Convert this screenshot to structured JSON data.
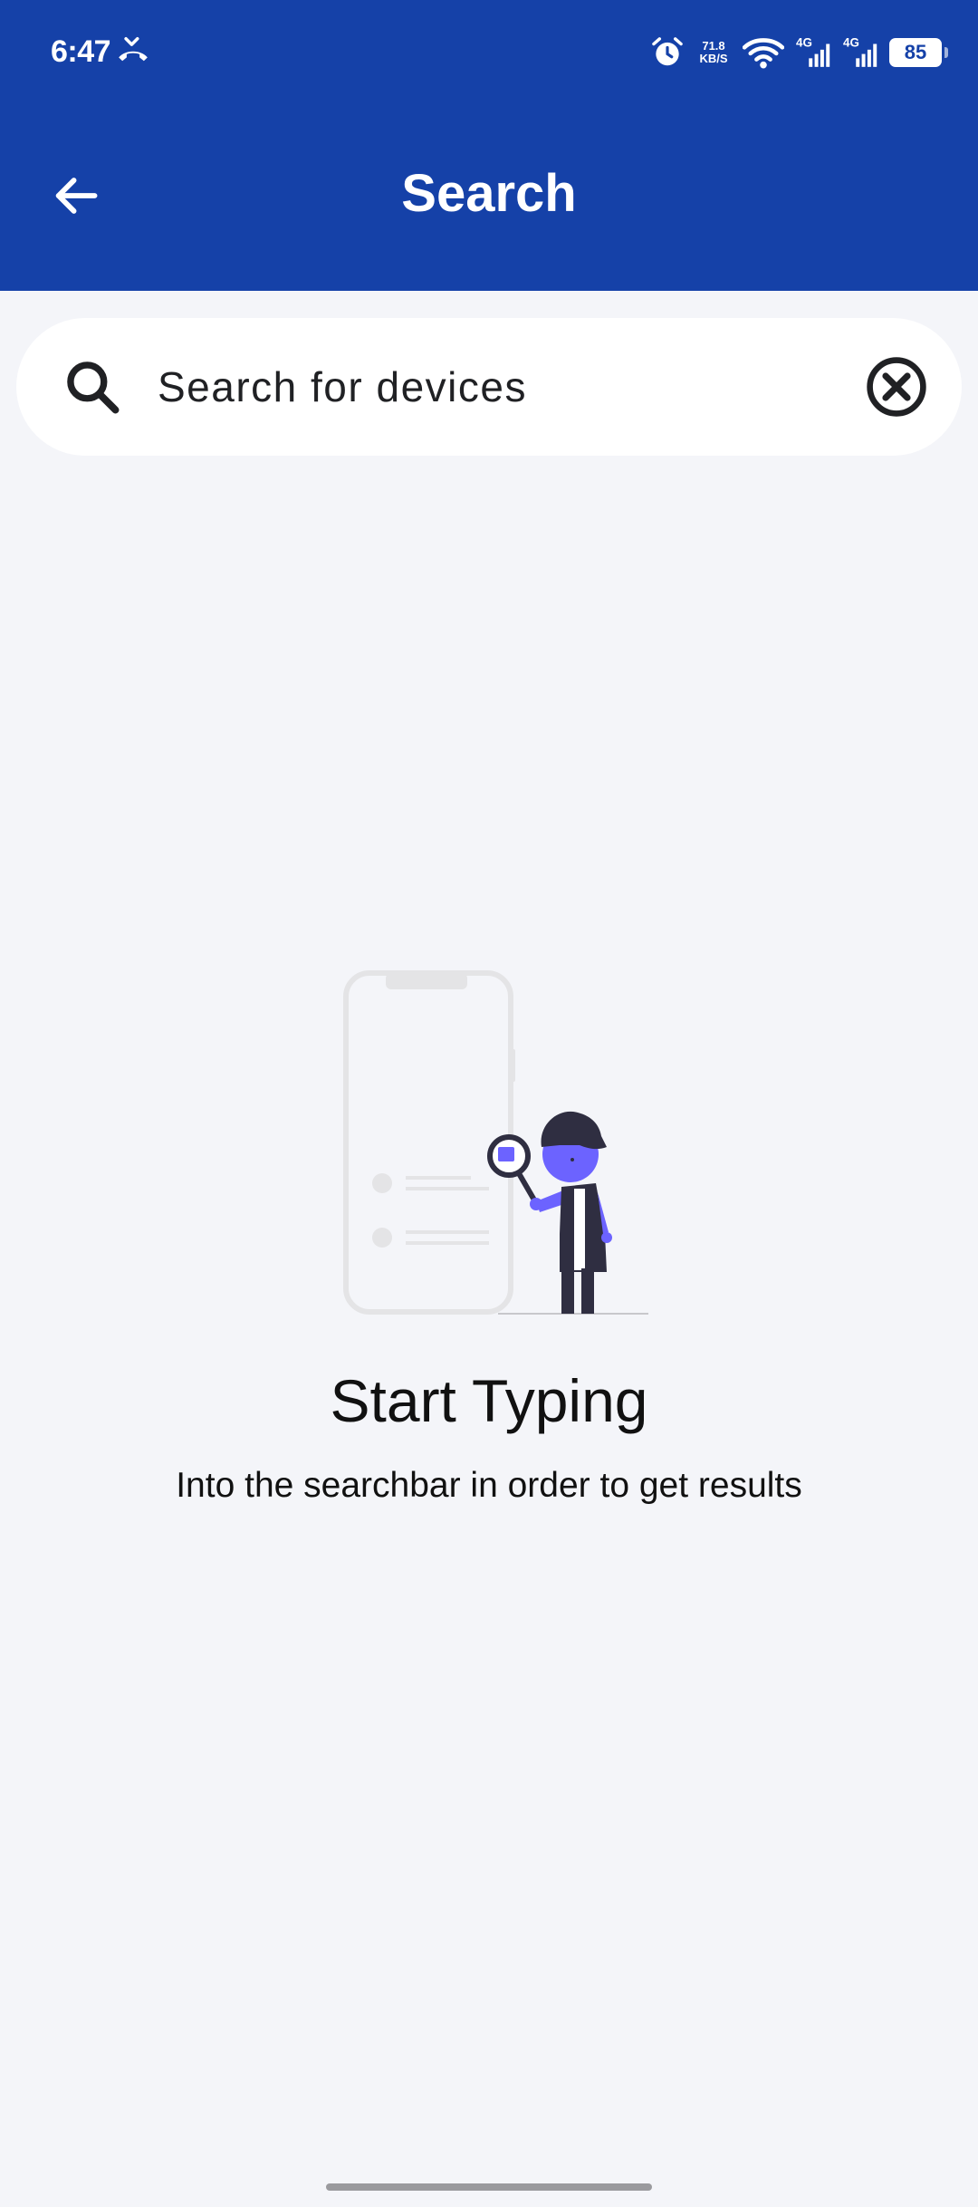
{
  "status_bar": {
    "time": "6:47",
    "call_icon": "missed-call-icon",
    "alarm_icon": "alarm-icon",
    "speed_value": "71.8",
    "speed_unit": "KB/S",
    "wifi_icon": "wifi-icon",
    "network_1_label": "4G",
    "network_2_label": "4G",
    "battery_level": "85"
  },
  "appbar": {
    "title": "Search",
    "back_icon": "arrow-left-icon",
    "background_color": "#1541a8"
  },
  "search": {
    "placeholder": "Search for devices",
    "value": "",
    "search_icon": "search-icon",
    "clear_icon": "close-circle-icon"
  },
  "empty_state": {
    "illustration": "person-with-magnifier-illustration",
    "title": "Start Typing",
    "subtitle": "Into the searchbar in order to get results",
    "accent_color": "#6c63ff"
  }
}
